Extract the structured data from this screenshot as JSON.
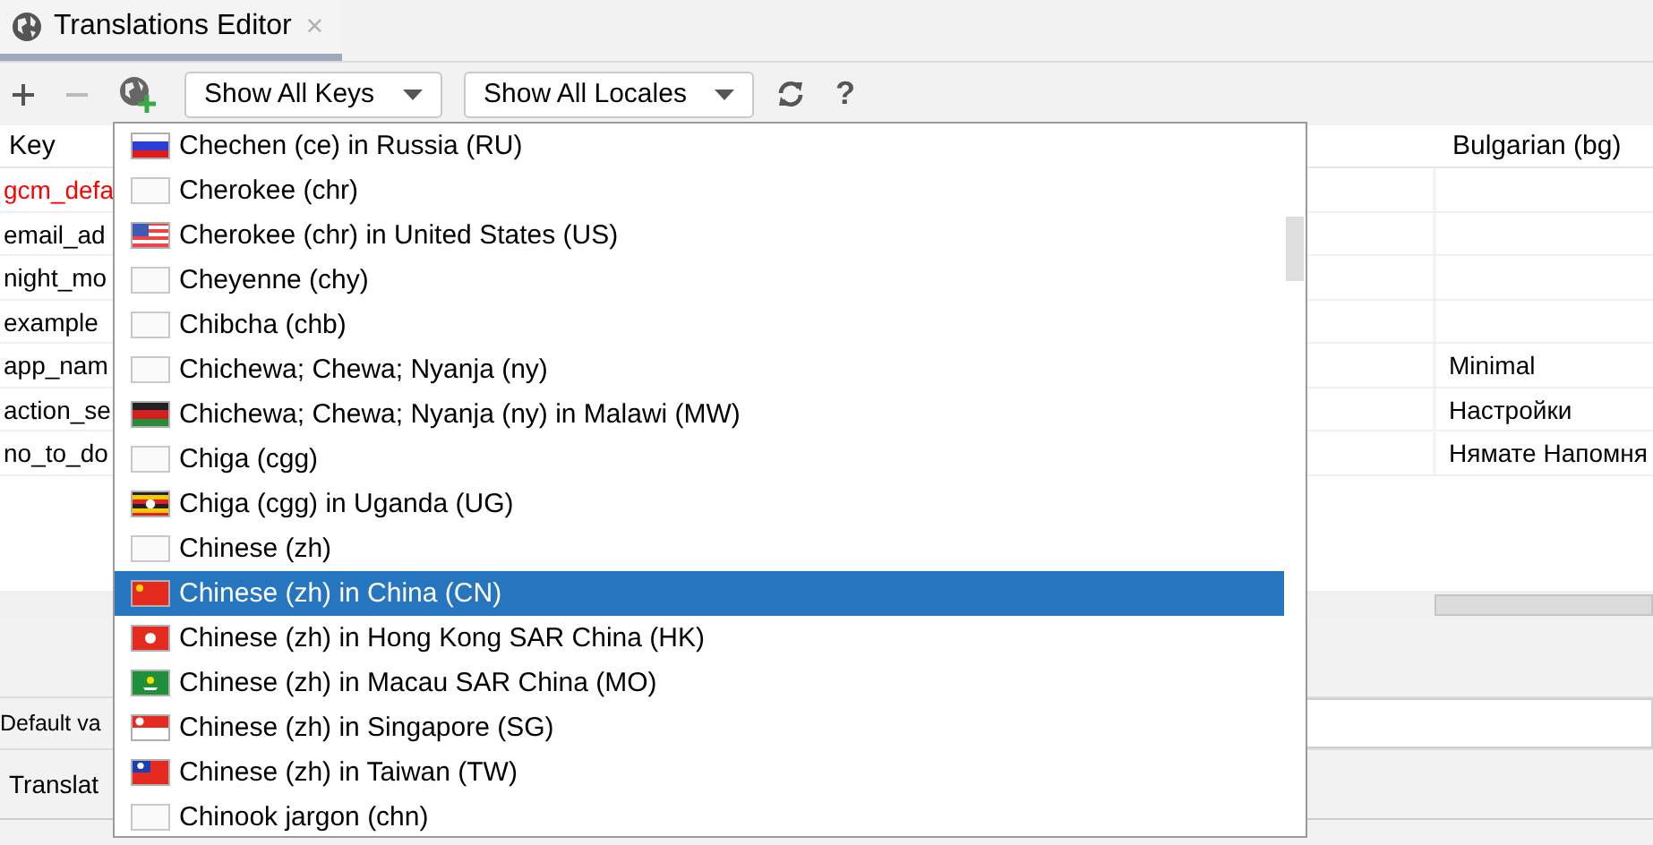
{
  "tab": {
    "title": "Translations Editor",
    "close": "×",
    "selected": true
  },
  "toolbar": {
    "keys_filter": "Show All Keys",
    "locales_filter": "Show All Locales",
    "help": "?"
  },
  "table": {
    "columns": [
      "Key",
      "Bulgarian (bg)"
    ],
    "rows": [
      {
        "key": "gcm_defa",
        "color": "#ff0000",
        "bulgarian": ""
      },
      {
        "key": "email_ad",
        "color": "#000000",
        "bulgarian": ""
      },
      {
        "key": "night_mo",
        "color": "#000000",
        "bulgarian": ""
      },
      {
        "key": "example",
        "color": "#000000",
        "bulgarian": ""
      },
      {
        "key": "app_nam",
        "color": "#000000",
        "bulgarian": "Minimal"
      },
      {
        "key": "action_se",
        "color": "#000000",
        "bulgarian": "Настройки"
      },
      {
        "key": "no_to_do",
        "color": "#000000",
        "bulgarian": "Нямате Напомня"
      }
    ]
  },
  "details": {
    "default_label": "Default va",
    "translation_label": "Translat"
  },
  "locale_menu": {
    "items": [
      {
        "label": "Chechen (ce) in Russia (RU)",
        "kind": "russia",
        "selected": false
      },
      {
        "label": "Cherokee (chr)",
        "kind": "none",
        "selected": false
      },
      {
        "label": "Cherokee (chr) in United States (US)",
        "kind": "usa",
        "selected": false
      },
      {
        "label": "Cheyenne (chy)",
        "kind": "none",
        "selected": false
      },
      {
        "label": "Chibcha (chb)",
        "kind": "none",
        "selected": false
      },
      {
        "label": "Chichewa; Chewa; Nyanja (ny)",
        "kind": "none",
        "selected": false
      },
      {
        "label": "Chichewa; Chewa; Nyanja (ny) in Malawi (MW)",
        "kind": "malawi",
        "selected": false
      },
      {
        "label": "Chiga (cgg)",
        "kind": "none",
        "selected": false
      },
      {
        "label": "Chiga (cgg) in Uganda (UG)",
        "kind": "uganda",
        "selected": false
      },
      {
        "label": "Chinese (zh)",
        "kind": "none",
        "selected": false
      },
      {
        "label": "Chinese (zh) in China (CN)",
        "kind": "china",
        "selected": true
      },
      {
        "label": "Chinese (zh) in Hong Kong SAR China (HK)",
        "kind": "hongkong",
        "selected": false
      },
      {
        "label": "Chinese (zh) in Macau SAR China (MO)",
        "kind": "macau",
        "selected": false
      },
      {
        "label": "Chinese (zh) in Singapore (SG)",
        "kind": "singapore",
        "selected": false
      },
      {
        "label": "Chinese (zh) in Taiwan (TW)",
        "kind": "taiwan",
        "selected": false
      },
      {
        "label": "Chinook jargon (chn)",
        "kind": "none",
        "selected": false
      }
    ]
  }
}
